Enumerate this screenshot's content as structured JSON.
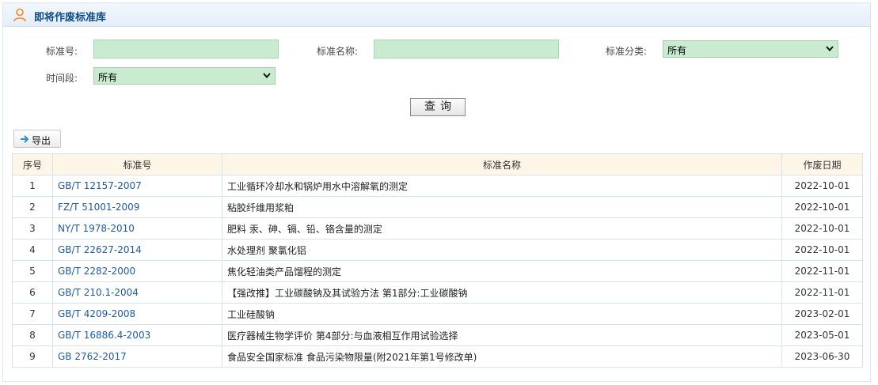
{
  "header": {
    "title": "即将作废标准库",
    "icon": "user-icon"
  },
  "filters": {
    "code_label": "标准号:",
    "code_value": "",
    "name_label": "标准名称:",
    "name_value": "",
    "category_label": "标准分类:",
    "category_value": "所有",
    "period_label": "时间段:",
    "period_value": "所有",
    "query_label": "查询"
  },
  "toolbar": {
    "export_label": "导出",
    "export_icon": "arrow-right-icon"
  },
  "table": {
    "columns": [
      "序号",
      "标准号",
      "标准名称",
      "作废日期"
    ],
    "rows": [
      {
        "no": "1",
        "code": "GB/T 12157-2007",
        "name": "工业循环冷却水和锅炉用水中溶解氧的测定",
        "date": "2022-10-01"
      },
      {
        "no": "2",
        "code": "FZ/T 51001-2009",
        "name": "粘胶纤维用浆粕",
        "date": "2022-10-01"
      },
      {
        "no": "3",
        "code": "NY/T 1978-2010",
        "name": "肥料 汞、砷、镉、铅、铬含量的测定",
        "date": "2022-10-01"
      },
      {
        "no": "4",
        "code": "GB/T 22627-2014",
        "name": "水处理剂 聚氯化铝",
        "date": "2022-10-01"
      },
      {
        "no": "5",
        "code": "GB/T 2282-2000",
        "name": "焦化轻油类产品馏程的测定",
        "date": "2022-11-01"
      },
      {
        "no": "6",
        "code": "GB/T 210.1-2004",
        "name": "【强改推】工业碳酸钠及其试验方法 第1部分:工业碳酸钠",
        "date": "2022-11-01"
      },
      {
        "no": "7",
        "code": "GB/T 4209-2008",
        "name": "工业硅酸钠",
        "date": "2023-02-01"
      },
      {
        "no": "8",
        "code": "GB/T 16886.4-2003",
        "name": "医疗器械生物学评价 第4部分:与血液相互作用试验选择",
        "date": "2023-05-01"
      },
      {
        "no": "9",
        "code": "GB 2762-2017",
        "name": "食品安全国家标准 食品污染物限量(附2021年第1号修改单)",
        "date": "2023-06-30"
      }
    ]
  },
  "colors": {
    "accent": "#1c5aa8",
    "input_bg": "#c9ecd1",
    "header_title": "#0b4a85",
    "th_bg": "#fdf5e6"
  }
}
